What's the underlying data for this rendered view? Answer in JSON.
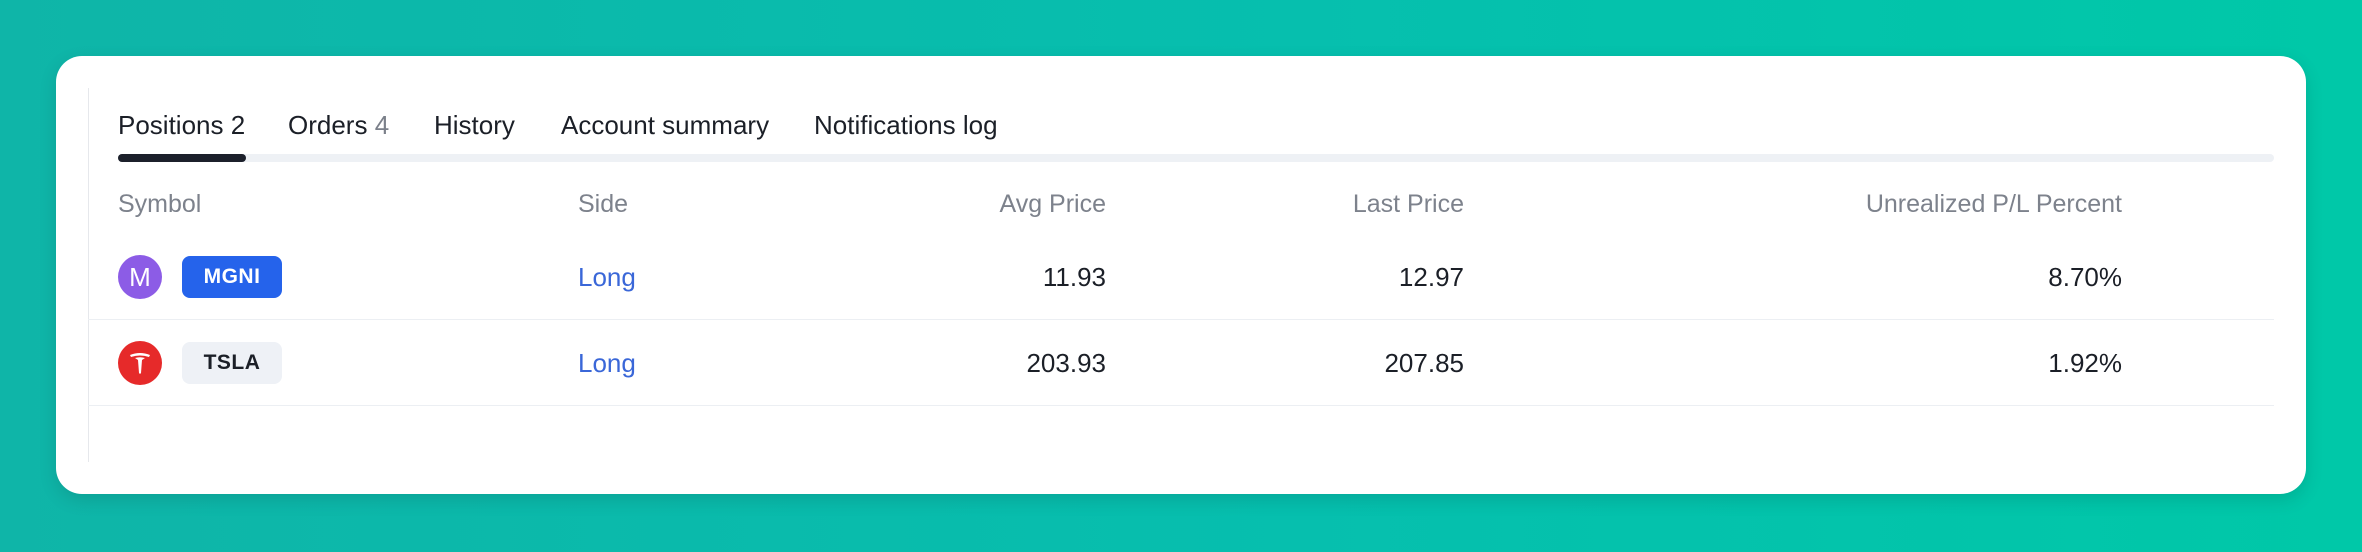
{
  "tabs": [
    {
      "label": "Positions",
      "count": "2"
    },
    {
      "label": "Orders",
      "count": "4"
    },
    {
      "label": "History",
      "count": ""
    },
    {
      "label": "Account summary",
      "count": ""
    },
    {
      "label": "Notifications log",
      "count": ""
    }
  ],
  "active_tab": "Positions",
  "table": {
    "headers": {
      "symbol": "Symbol",
      "side": "Side",
      "avg_price": "Avg Price",
      "last_price": "Last Price",
      "unrealized_pl_percent": "Unrealized P/L Percent"
    },
    "rows": [
      {
        "logo_letter": "M",
        "logo_icon": "letter-m-icon",
        "symbol": "MGNI",
        "side": "Long",
        "avg_price": "11.93",
        "last_price": "12.97",
        "unrealized_pl_percent": "8.70%"
      },
      {
        "logo_letter": "",
        "logo_icon": "tesla-logo-icon",
        "symbol": "TSLA",
        "side": "Long",
        "avg_price": "203.93",
        "last_price": "207.85",
        "unrealized_pl_percent": "1.92%"
      }
    ]
  },
  "colors": {
    "background_gradient": [
      "#0fb5a8",
      "#00c8a8"
    ],
    "side_long": "#3a67d8",
    "chip_blue": "#2563eb",
    "tab_active": "#1c202b"
  }
}
